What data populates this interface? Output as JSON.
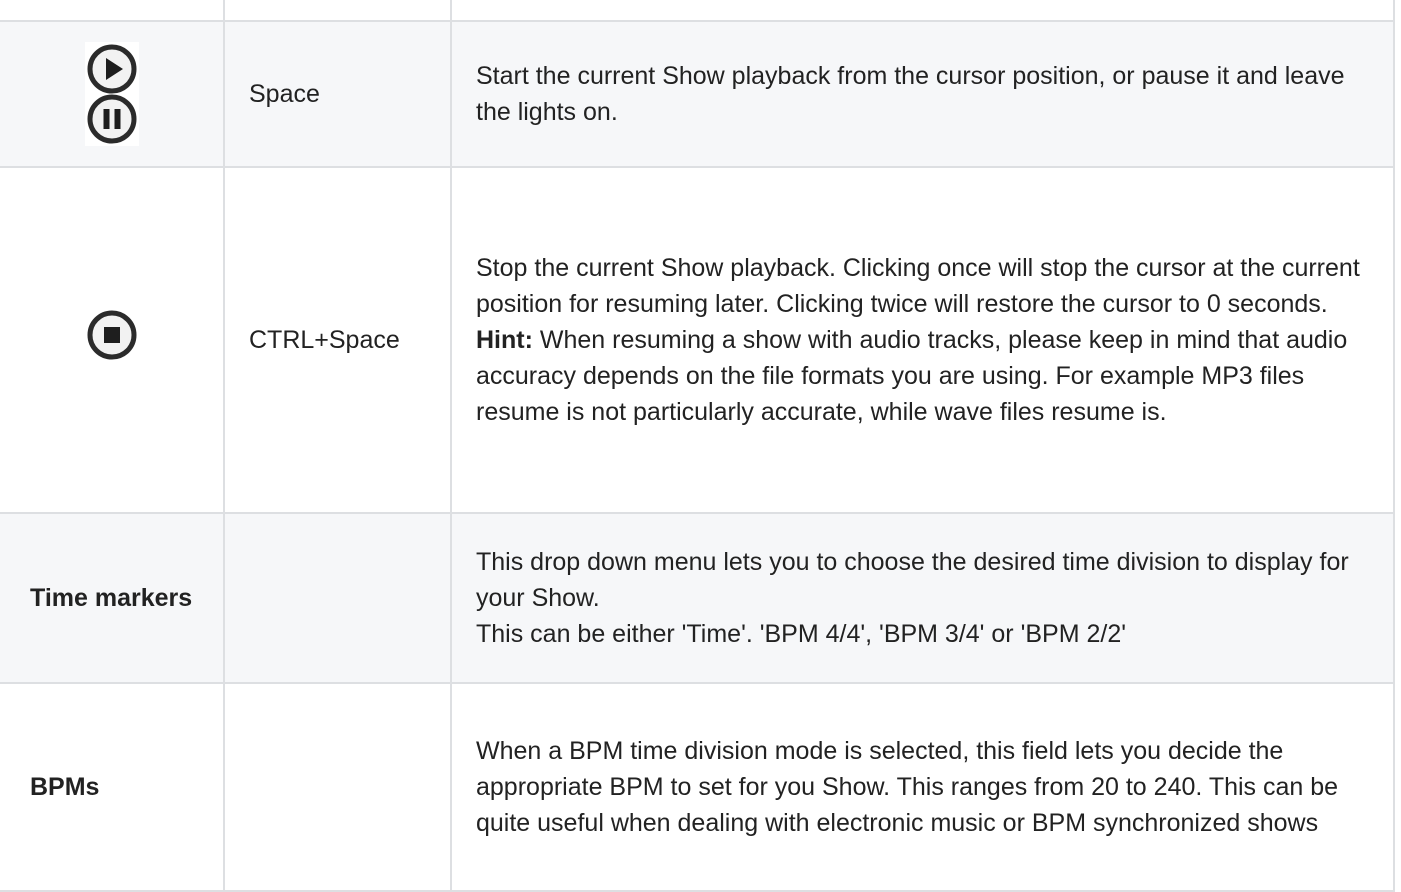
{
  "rows": [
    {
      "icon": [
        "play-icon",
        "pause-icon"
      ],
      "key": "Space",
      "description": "Start the current Show playback from the cursor position, or pause it and leave the lights on."
    },
    {
      "icon": [
        "stop-icon"
      ],
      "key": "CTRL+Space",
      "description": "Stop the current Show playback. Clicking once will stop the cursor at the current position for resuming later. Clicking twice will restore the cursor to 0 seconds.",
      "hint_label": "Hint:",
      "hint_text": "When resuming a show with audio tracks, please keep in mind that audio accuracy depends on the file formats you are using. For example MP3 files resume is not particularly accurate, while wave files resume is."
    },
    {
      "label": "Time markers",
      "key": "",
      "description_lines": [
        "This drop down menu lets you to choose the desired time division to display for your Show.",
        "This can be either 'Time'. 'BPM 4/4', 'BPM 3/4' or 'BPM 2/2'"
      ]
    },
    {
      "label": "BPMs",
      "key": "",
      "description": "When a BPM time division mode is selected, this field lets you decide the appropriate BPM to set for you Show. This ranges from 20 to 240. This can be quite useful when dealing with electronic music or BPM synchronized shows"
    }
  ],
  "colors": {
    "border": "#dddfe2",
    "shaded_row": "#f6f7f9",
    "text": "#222222"
  }
}
